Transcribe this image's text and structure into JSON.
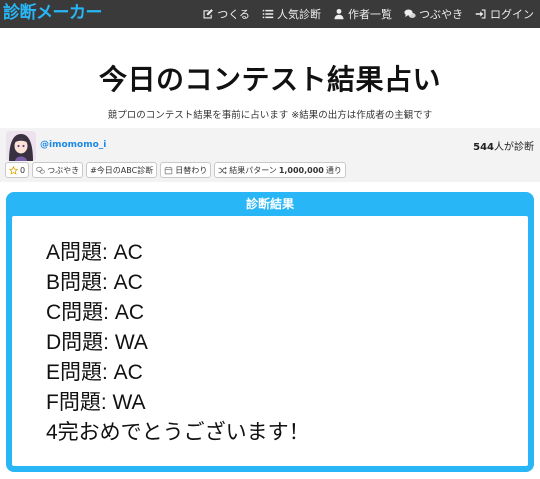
{
  "navbar": {
    "brand": "診断メーカー",
    "items": [
      {
        "label": "つくる",
        "icon": "pencil-square-icon"
      },
      {
        "label": "人気診断",
        "icon": "list-icon"
      },
      {
        "label": "作者一覧",
        "icon": "user-icon"
      },
      {
        "label": "つぶやき",
        "icon": "comments-icon"
      },
      {
        "label": "ログイン",
        "icon": "sign-in-icon"
      }
    ]
  },
  "page": {
    "title": "今日のコンテスト結果占い",
    "description": "競プロのコンテスト結果を事前に占います ※結果の出方は作成者の主観です"
  },
  "author": {
    "name": "@imomomo_i",
    "count": "544",
    "count_suffix": "人が診断"
  },
  "tags": {
    "favorite_count": "0",
    "tweets": "つぶやき",
    "hashtag": "#今日のABC診断",
    "daily": "日替わり",
    "pattern_prefix": "結果パターン",
    "pattern_count": "1,000,000",
    "pattern_suffix": "通り"
  },
  "result": {
    "header": "診断結果",
    "lines": [
      "A問題: AC",
      "B問題: AC",
      "C問題: AC",
      "D問題: WA",
      "E問題: AC",
      "F問題: WA",
      "4完おめでとうございます！"
    ]
  },
  "colors": {
    "navbar_bg": "#3a3a3a",
    "brand": "#29b6f6",
    "accent": "#29b6f6",
    "author_link": "#1e88e5"
  }
}
